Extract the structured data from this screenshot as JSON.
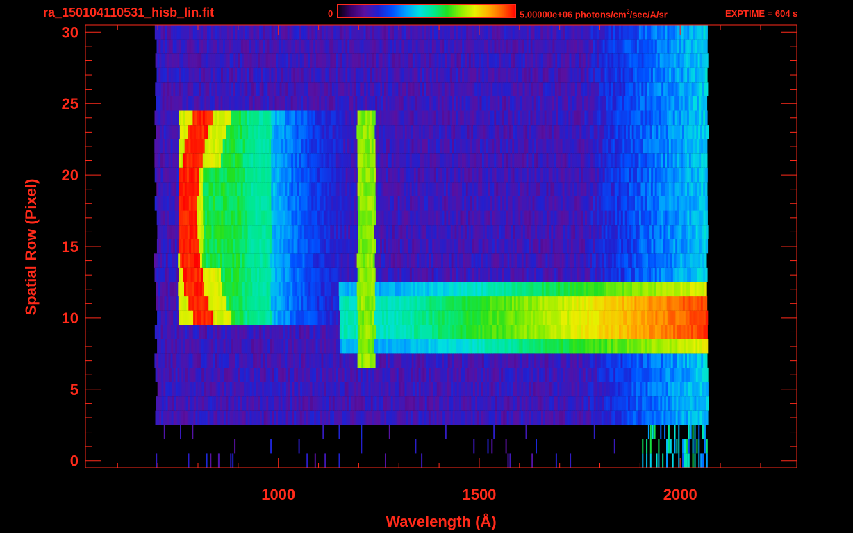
{
  "header": {
    "filename": "ra_150104110531_hisb_lin.fit",
    "colorbar_min_label": "0",
    "colorbar_max_label_pre": "5.00000e+06 photons/cm",
    "colorbar_max_label_sup": "2",
    "colorbar_max_label_post": "/sec/A/sr",
    "exptime_label": "EXPTIME = 604 s"
  },
  "colors": {
    "foreground": "#ff2a1a",
    "background": "#000000"
  },
  "colormap": [
    "#000000",
    "#3a006a",
    "#5a10a0",
    "#2020d0",
    "#0050ff",
    "#00a0ff",
    "#00e0e0",
    "#00e890",
    "#20e020",
    "#90ee00",
    "#e8f000",
    "#ffb000",
    "#ff6000",
    "#ff0000"
  ],
  "chart_data": {
    "type": "heatmap",
    "title": "ra_150104110531_hisb_lin.fit",
    "xlabel": "Wavelength (Å)",
    "ylabel": "Spatial Row (Pixel)",
    "xlim": [
      520,
      2290
    ],
    "ylim": [
      -0.5,
      30.5
    ],
    "x_tick_labels": [
      "1000",
      "1500",
      "2000"
    ],
    "y_tick_labels": [
      "0",
      "5",
      "10",
      "15",
      "20",
      "25",
      "30"
    ],
    "zlim": [
      0,
      5000000
    ],
    "zunit": "photons/cm^2/sec/A/sr",
    "colorbar": true,
    "grid": false,
    "data_extent_x": [
      690,
      2065
    ],
    "features": [
      {
        "name": "Lyman-alpha line",
        "x": 1216,
        "rows": [
          7,
          24
        ],
        "level": 0.65
      },
      {
        "name": "bright feature near 900 A",
        "x_range": [
          770,
          900
        ],
        "rows": [
          10,
          24
        ],
        "level": 1.0
      },
      {
        "name": "continuum band",
        "x_range": [
          1300,
          2060
        ],
        "rows": [
          8,
          12
        ],
        "level_start": 0.5,
        "level_end": 0.95
      }
    ]
  }
}
